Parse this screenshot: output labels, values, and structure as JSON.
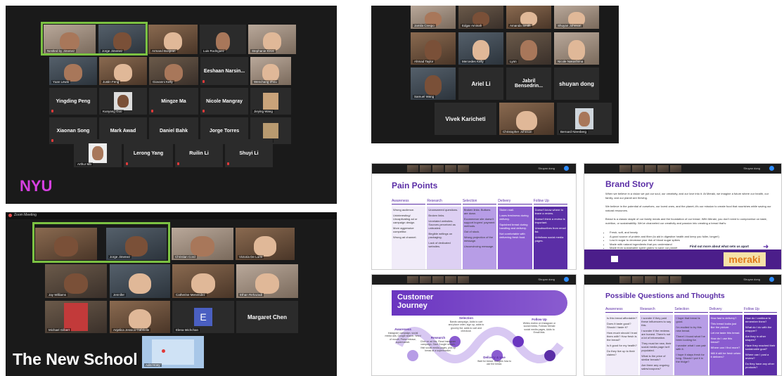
{
  "nyu": {
    "label": "NYU",
    "tiles": {
      "t1": "Nestled by Jimenez",
      "t2": "Jorge Jimenez",
      "t3": "Armand Bonjean",
      "t4": "Luis Rodriguez",
      "t5": "Stephanie Kiros",
      "t6": "Yuan Lewis",
      "t7": "Justin Feng",
      "t8": "Giovanni Kelly",
      "t9": "Eeshaan Narsin...",
      "t10": "Wenchang Zhou",
      "t11": "Yingding Peng",
      "t12": "Kunyang Guo",
      "t13": "Mingze Ma",
      "t14": "Nicole Mangray",
      "t15": "Jieying Wang",
      "t16": "Xiaonan Song",
      "t17": "Mark Awad",
      "t18": "Daniel Bahk",
      "t19": "Jorge Torres",
      "t20": "Fuxpeng Niu",
      "t21": "Arthur Ma",
      "t22": "Lerong Yang",
      "t23": "Ruilin Li",
      "t24": "Shuyi Li"
    }
  },
  "tns": {
    "label": "The New School",
    "tiles": {
      "t1": "Jorge Jimenez",
      "t2": "",
      "t3": "Christian Cord",
      "t4": "Victoria De Lorm",
      "t5": "Jay Williams",
      "t6": "Jennifer",
      "t7": "Catherine Menendez",
      "t8": "Ethan Rehazadi",
      "t9": "Michael Gilbert",
      "t10": "Anjelica Jessica Gabrielle",
      "t11": "Elena Michchan",
      "t12": "Margaret Chen",
      "t13": "Aditi Hoey",
      "e_initial": "E"
    },
    "app_title": "Zoom Meeting"
  },
  "top_right": {
    "tiles": {
      "t1": "Jamila Crespo",
      "t2": "Edgar Aminah",
      "t3": "Amanda Smith",
      "t4": "Shuyan Johnson",
      "t5": "Ahmad Taylor",
      "t6": "Mercedes Kelly",
      "t7": "Lynn",
      "t8": "Nicole Nakashima",
      "t9": "Samuel Wang",
      "t10": "Ariel Li",
      "t11": "Jabril Bensedrin...",
      "t12": "shuyan dong",
      "t13": "Vivek Karicheti",
      "t14": "Christopher Johnson",
      "t15": "Bernard Nirenberg"
    }
  },
  "slide_pain": {
    "title": "Pain Points",
    "columns": [
      {
        "head": "Awareness",
        "items": [
          "Wrong audience.",
          "Uninteresting/ Uncaptivating ad or campaign design.",
          "More aggressive competitor.",
          "Wrong ad channel."
        ]
      },
      {
        "head": "Research",
        "items": [
          "Unanswered questions.",
          "Broken links.",
          "Unrelated websites. Sources perceived as untrusted.",
          "Illegible writings on packaging.",
          "Lack of dedicated websites."
        ]
      },
      {
        "head": "Selection",
        "items": [
          "Broken links. Buttons are down.",
          "Ecommerce site doesn't support buyers' payment methods.",
          "Out of stock.",
          "Wrong projection of the message.",
          "Unconvincing message."
        ]
      },
      {
        "head": "Delivery",
        "items": [
          "Stolen mail.",
          "Loses freshness during delivery.",
          "Squished bread during handling and delivery.",
          "Not comfortable with delivering fresh food."
        ]
      },
      {
        "head": "Follow Up",
        "items": [
          "Doesn't know where to leave a review.",
          "Doesn't think a review is important.",
          "Unsubscribes from email list.",
          "Unfollows social media pages."
        ]
      }
    ]
  },
  "slide_brand": {
    "title": "Brand Story",
    "p1": "When we believe in a vision we put our soul, our creativity, and our love into it. At Meraki, we imagine a future where our health, our family, and our planet are thriving.",
    "p2": "We believe in the potential of ourselves, our loved ones, and the planet–it's our mission to create food that nourishes while saving our natural resources.",
    "p3": "Bread is a classic staple of our family meals and the foundation of our bread. With Meraki, you don't need to compromise on taste, nutrition, or sustainability. We've channeled our creativity and passion into creating a bread that's:",
    "bullets": [
      "Fresh, soft, and hearty",
      "A good source of protein and fiber (to aid in digestive health and keep you fuller, longer!)",
      "Low in sugar to decrease your risk of blood sugar spikes",
      "Made with natural ingredients that you understand",
      "Made from sustainable spent grains to save our planet"
    ],
    "cta": "Find out more about what sets us apart",
    "brand": "meraki"
  },
  "slide_journey": {
    "title_line1": "Customer",
    "title_line2": "Journey",
    "stages": [
      {
        "name": "Awareness",
        "text": "Instagram campaign, social media ads, Google search, Word of mouth, Press release, supermarket."
      },
      {
        "name": "Research",
        "text": "Click on ad link, Read Instagram campaign, Start Google search, Visit social media pages, pick up bread at a supermarket."
      },
      {
        "name": "Selection",
        "text": "Bands campaign, Adds to cart and place order, sign up, adds to grocery list, adds to cart and checkout."
      },
      {
        "name": "Delivery & Use",
        "text": "Wait for bread, Googles how to use the bread."
      },
      {
        "name": "Follow Up",
        "text": "Writes review on Instagram or social media, Follows Meraki social media pages, Adds to Email lists."
      }
    ]
  },
  "slide_questions": {
    "title": "Possible Questions and Thoughts",
    "columns": [
      {
        "head": "Awareness",
        "items": [
          "Is this bread affordable?",
          "Does it taste good? Should I taste it?",
          "How much should I trust them with? How fresh is the bread?",
          "Is it good for my health?",
          "Do they live up to their claims?"
        ]
      },
      {
        "head": "Research",
        "items": [
          "I wonder if they paid these influencers to say this.",
          "I wonder if the reviews are honest. There's not a lot of information.",
          "They must be new, their social media page isn't populated.",
          "What is the price of similar breads?",
          "Are there any ongoing sales/coupons?"
        ]
      },
      {
        "head": "Selection",
        "items": [
          "I hope that bread is good.",
          "I'm excited to try this new bread.",
          "There! I found what I've been looking for.",
          "I wonder what I can pair with it.",
          "I hope it stays fresh for long. Should I put it in the fridge?"
        ]
      },
      {
        "head": "Delivery",
        "items": [
          "How fast is delivery?",
          "This bread looks just like the picture.",
          "Let me taste this bread.",
          "How do I use this bread?",
          "Where can I find more?",
          "Will it still be fresh when it delivers?"
        ]
      },
      {
        "head": "Follow Up",
        "items": [
          "How do I continue to remember them?",
          "What do I do with the wrapper?",
          "Are they in other shapes?",
          "Have they reached their sustainable goal?",
          "Where can I post a review?",
          "Do they have any other products?"
        ]
      }
    ]
  },
  "share_host": "Shuyan dong"
}
